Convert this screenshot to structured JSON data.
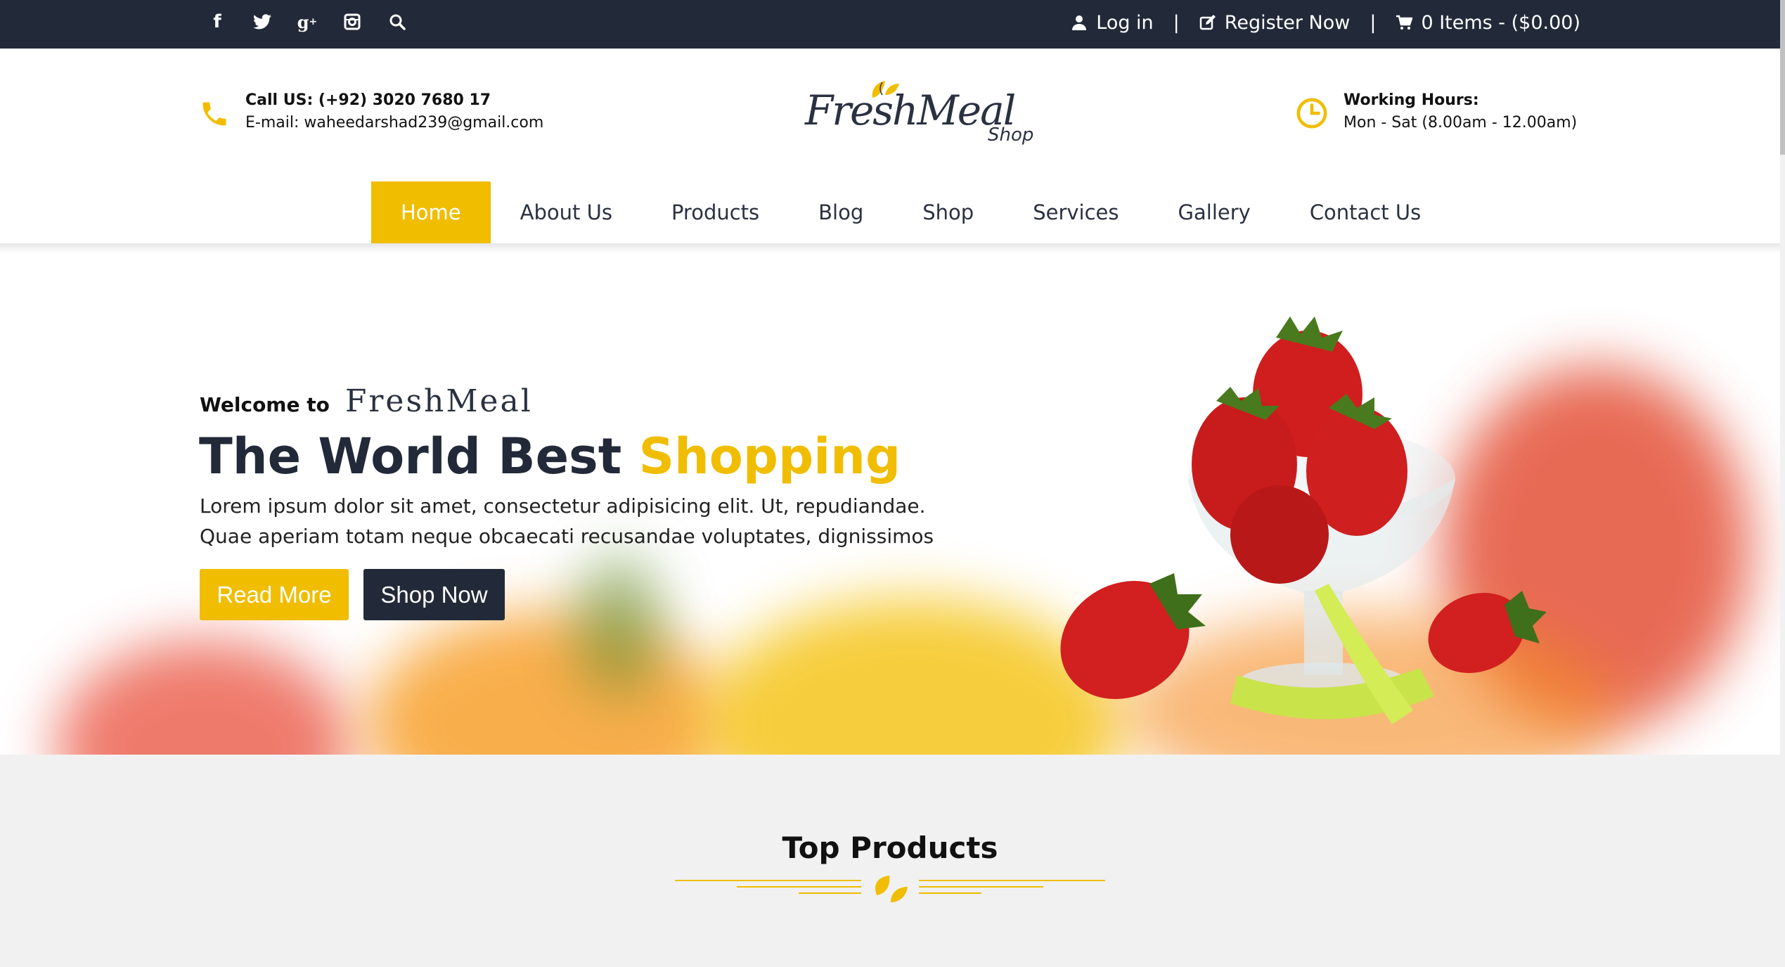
{
  "topbar": {
    "social_icons": [
      "facebook-icon",
      "twitter-icon",
      "google-plus-icon",
      "instagram-icon",
      "search-icon"
    ],
    "login": "Log in",
    "register": "Register Now",
    "separator": "|",
    "cart": "0 Items - ($0.00)"
  },
  "header": {
    "call": "Call US: (+92) 3020 7680 17",
    "email": "E-mail: waheedarshad239@gmail.com",
    "logo_main": "FreshMeal",
    "logo_sub": "Shop",
    "hours_title": "Working Hours:",
    "hours_value": "Mon - Sat (8.00am - 12.00am)"
  },
  "nav": {
    "items": [
      "Home",
      "About Us",
      "Products",
      "Blog",
      "Shop",
      "Services",
      "Gallery",
      "Contact Us"
    ],
    "active": "Home"
  },
  "hero": {
    "welcome": "Welcome to",
    "brand": "FreshMeal",
    "headline_a": "The World Best ",
    "headline_b": "Shopping",
    "desc_1": "Lorem ipsum dolor sit amet, consectetur adipisicing elit. Ut, repudiandae.",
    "desc_2": "Quae aperiam totam neque obcaecati recusandae voluptates, dignissimos",
    "read_more": "Read More",
    "shop_now": "Shop Now"
  },
  "products": {
    "title": "Top Products"
  },
  "colors": {
    "accent": "#f0bd00",
    "dark": "#222a39",
    "section_bg": "#f1f1f1"
  }
}
